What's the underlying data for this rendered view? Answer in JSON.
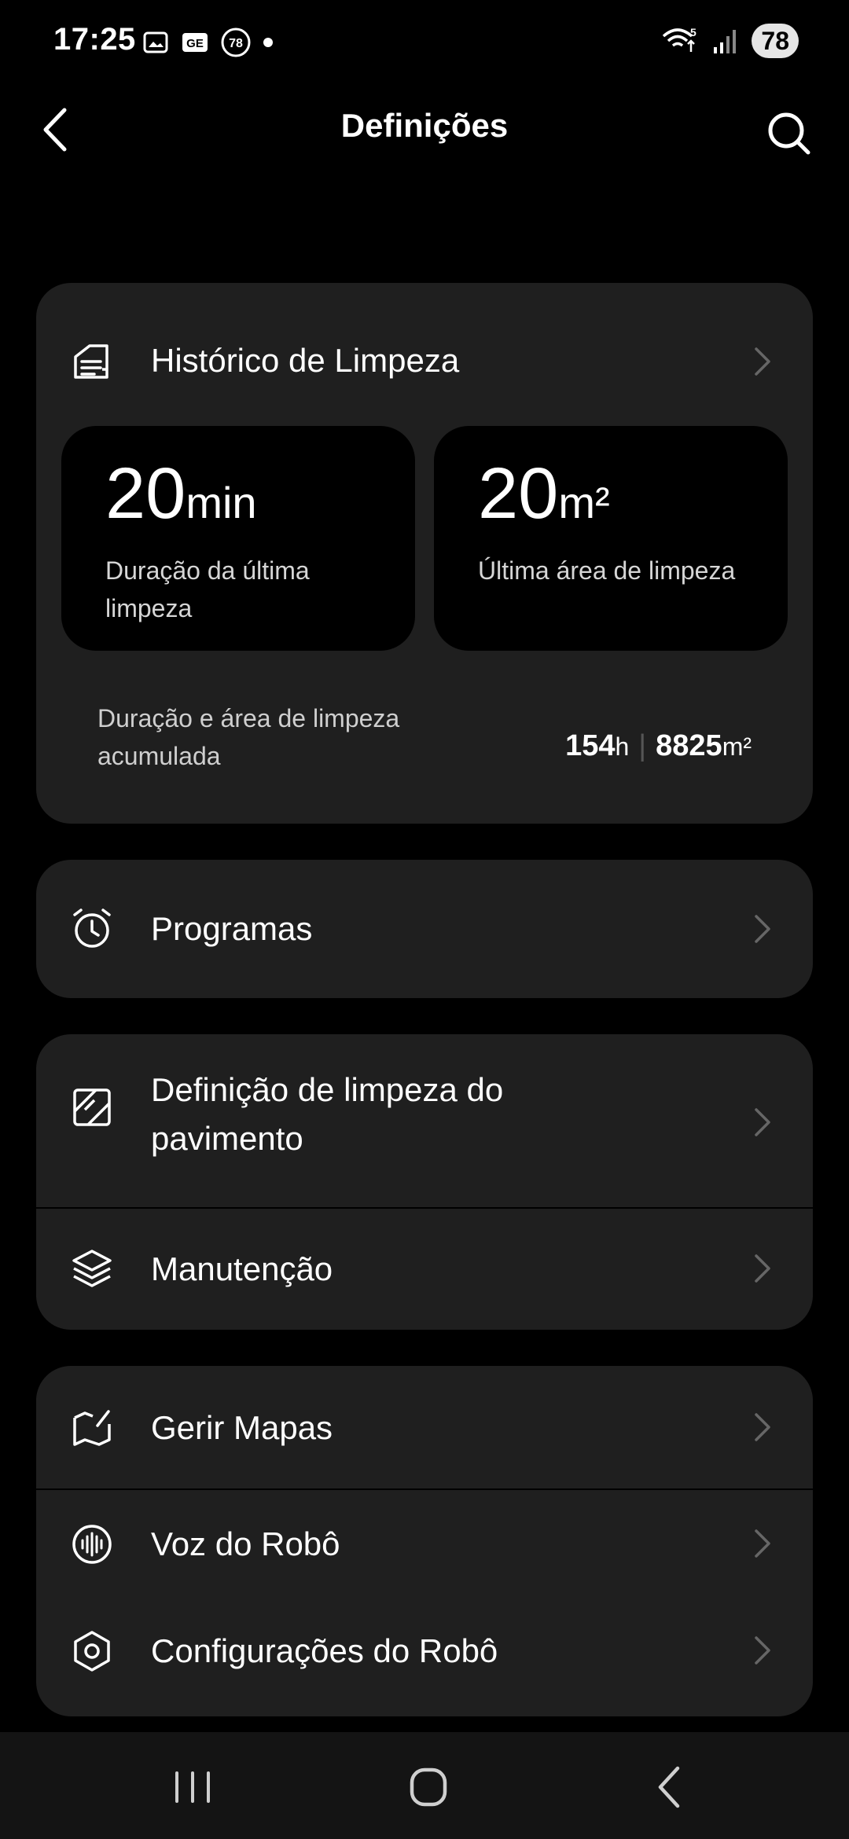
{
  "status": {
    "time": "17:25",
    "battery": "78",
    "notif_badge": "78",
    "sim_label": "5"
  },
  "header": {
    "title": "Definições"
  },
  "history": {
    "title": "Histórico de Limpeza",
    "last_duration_value": "20",
    "last_duration_unit": "min",
    "last_duration_caption": "Duração da última limpeza",
    "last_area_value": "20",
    "last_area_unit": "m²",
    "last_area_caption": "Última área de limpeza",
    "total_caption": "Duração e área de limpeza acumulada",
    "total_hours": "154",
    "total_hours_unit": "h",
    "total_area": "8825",
    "total_area_unit": "m²"
  },
  "menu": {
    "programs": "Programas",
    "floor_settings": "Definição de limpeza do pavimento",
    "maintenance": "Manutenção",
    "manage_maps": "Gerir Mapas",
    "robot_voice": "Voz do Robô",
    "robot_settings": "Configurações do Robô"
  },
  "icons": {
    "back": "back-arrow-icon",
    "search": "search-icon",
    "history": "history-icon",
    "programs": "alarm-clock-icon",
    "floor": "floor-tile-icon",
    "maintenance": "layers-icon",
    "maps": "map-icon",
    "voice": "sound-wave-icon",
    "robot": "hexagon-settings-icon"
  }
}
